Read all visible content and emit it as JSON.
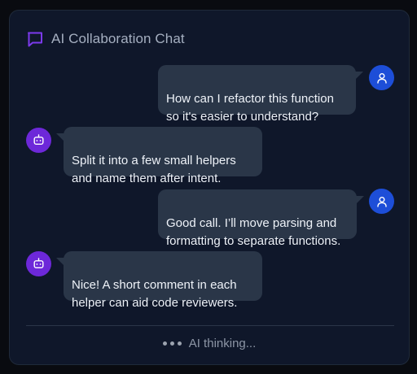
{
  "header": {
    "title": "AI Collaboration Chat",
    "icon": "chat-bubble-icon"
  },
  "colors": {
    "accent": "#7c3aed",
    "user_avatar": "#1d4ed8",
    "ai_avatar": "#6d28d9",
    "bubble": "#2a3648",
    "panel": "#0f172a"
  },
  "messages": [
    {
      "role": "user",
      "text": "How can I refactor this function\nso it's easier to understand?"
    },
    {
      "role": "ai",
      "text": "Split it into a few small helpers\nand name them after intent."
    },
    {
      "role": "user",
      "text": "Good call. I’ll move parsing and\nformatting to separate functions."
    },
    {
      "role": "ai",
      "text": "Nice! A short comment in each\nhelper can aid code reviewers."
    }
  ],
  "status": {
    "label": "AI thinking..."
  }
}
